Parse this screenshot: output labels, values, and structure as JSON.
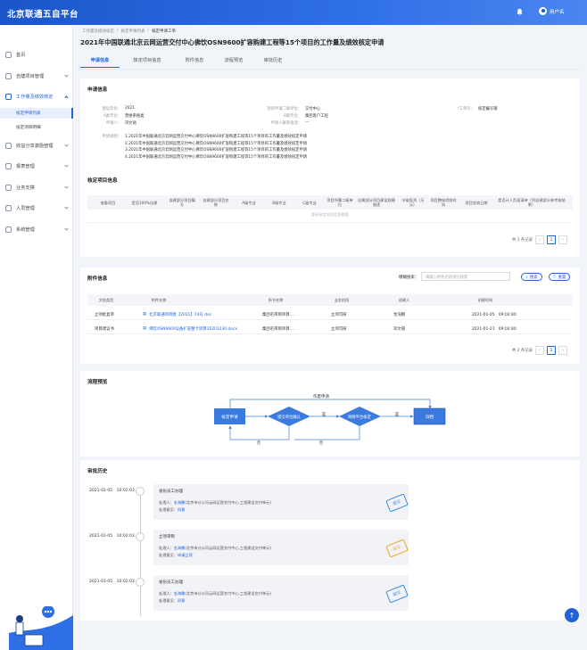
{
  "app": {
    "title": "北京联通五自平台"
  },
  "header": {
    "user_name": "用户名"
  },
  "sidebar": {
    "items": [
      {
        "label": "首页"
      },
      {
        "label": "自建项目管理"
      },
      {
        "label": "工作量及绩效核定"
      },
      {
        "label": "收益分享激励管理"
      },
      {
        "label": "报表管理"
      },
      {
        "label": "业务支撑"
      },
      {
        "label": "人员管理"
      },
      {
        "label": "系统管理"
      }
    ],
    "sub_items": [
      {
        "label": "核定申请列表"
      },
      {
        "label": "核定项目明细"
      }
    ]
  },
  "breadcrumb": [
    "工作量及绩效核定",
    "核定申请列表",
    "核定申请工单"
  ],
  "page_title": "2021年中国联通北京云网运营交付中心佛饮OSN9600扩容购建工程等15个项目的工作量及绩效核定申请",
  "tabs": [
    "申请信息",
    "核定项目信息",
    "附件信息",
    "流程预览",
    "审批历史"
  ],
  "apply_info": {
    "title": "申请信息",
    "fields": [
      {
        "k": "建设年份：",
        "v": "2021"
      },
      {
        "k": "项目申请二级单位：",
        "v": "交付中心"
      },
      {
        "k": "*工单号：",
        "v": "核定编号钢"
      },
      {
        "k": "A类专业：",
        "v": "营维系统类"
      },
      {
        "k": "B级专业：",
        "v": "集团客户工程"
      },
      {
        "k": "申请人：",
        "v": "邓文丽"
      },
      {
        "k": "申请人联系电话：",
        "v": "---"
      }
    ],
    "desc_label": "申请说明：",
    "desc_lines": [
      "1.2021年中国联通北京云网运营交付中心佛饮OSN9600扩容购建工程等15个项目的工作量及绩效核定申请",
      "2.2021年中国联通北京云网运营交付中心佛饮OSN9600扩容购建工程等15个项目的工作量及绩效核定申请",
      "3.2021年中国联通北京云网运营交付中心佛饮OSN9600扩容购建工程等15个项目的工作量及绩效核定申请",
      "4.2021年中国联通北京云网运营交付中心佛饮OSN9600扩容购建工程等15个项目的工作量及绩效核定申请"
    ]
  },
  "project_info": {
    "title": "核定项目信息",
    "columns": [
      "查看项目",
      "是否100%自建",
      "自建部分项目编号",
      "自建部分项目名称",
      "A级专业",
      "B级专业",
      "C级专业",
      "项目所属二级单位",
      "自建部分项目建设规模描述",
      "节省投资（万元）",
      "项目整体验收时间",
      "项目验收日期",
      "是否计入负面清单（列自建部分参考核结果）"
    ],
    "empty_text": "暂无核定项目信息数据",
    "total": "共 3 条记录",
    "page": "1"
  },
  "attachments": {
    "title": "附件信息",
    "search_label": "模糊搜索：",
    "search_placeholder": "请输入附件名称进行搜索",
    "search_button": "搜索",
    "reset_button": "重置",
    "columns": [
      "文档类型",
      "附件名称",
      "所节名称",
      "业务阶段",
      "创建人",
      "创建时间"
    ],
    "rows": [
      {
        "type": "立项批复单",
        "name": "北京联通项目批【2021】74号.doc",
        "node": "集团名审制项目…",
        "stage": "立项可研",
        "creator": "金海鹏",
        "time": "2021-01-05　09:02:80"
      },
      {
        "type": "项目建议书",
        "name": "佛饮OSN9600设备扩容整卡项目20201230.docx",
        "node": "集团名审制项目…",
        "stage": "立项可研",
        "creator": "邓文丽",
        "time": "2021-01-21　09:02:80"
      }
    ],
    "total": "共 2 条记录",
    "page": "1"
  },
  "flow": {
    "title": "流程预览",
    "top_label": "作废申请",
    "nodes": [
      "核定申请",
      "提交单位确认",
      "网络平台核定",
      "归档"
    ],
    "yes_label": "是",
    "no_label": "否"
  },
  "history": {
    "title": "审批历史",
    "entries": [
      {
        "time": "2021-01-05　10:02:03",
        "node": "省份员工办理",
        "handler": "处理人：金海鹏(北京市分公司云网运营交付中心.工程建设交付单元)",
        "opinion": "处理意见：同意",
        "stamp": "提交",
        "stamp_color": "#3b8ee0"
      },
      {
        "time": "2021-01-05　10:02:03",
        "node": "立项审制",
        "handler": "处理人：金海鹏(北京市分公司云网运营交付中心.工程建设交付单元)",
        "opinion": "处理意见：申请立项",
        "stamp": "提交",
        "stamp_color": "#f0a529"
      },
      {
        "time": "2021-01-05　10:02:03",
        "node": "省份员工办理",
        "handler": "处理人：金海鹏(北京市分公司云网运营交付中心.工程建设交付单元)",
        "opinion": "处理意见：同意",
        "stamp": "提交",
        "stamp_color": "#3b8ee0"
      }
    ]
  }
}
